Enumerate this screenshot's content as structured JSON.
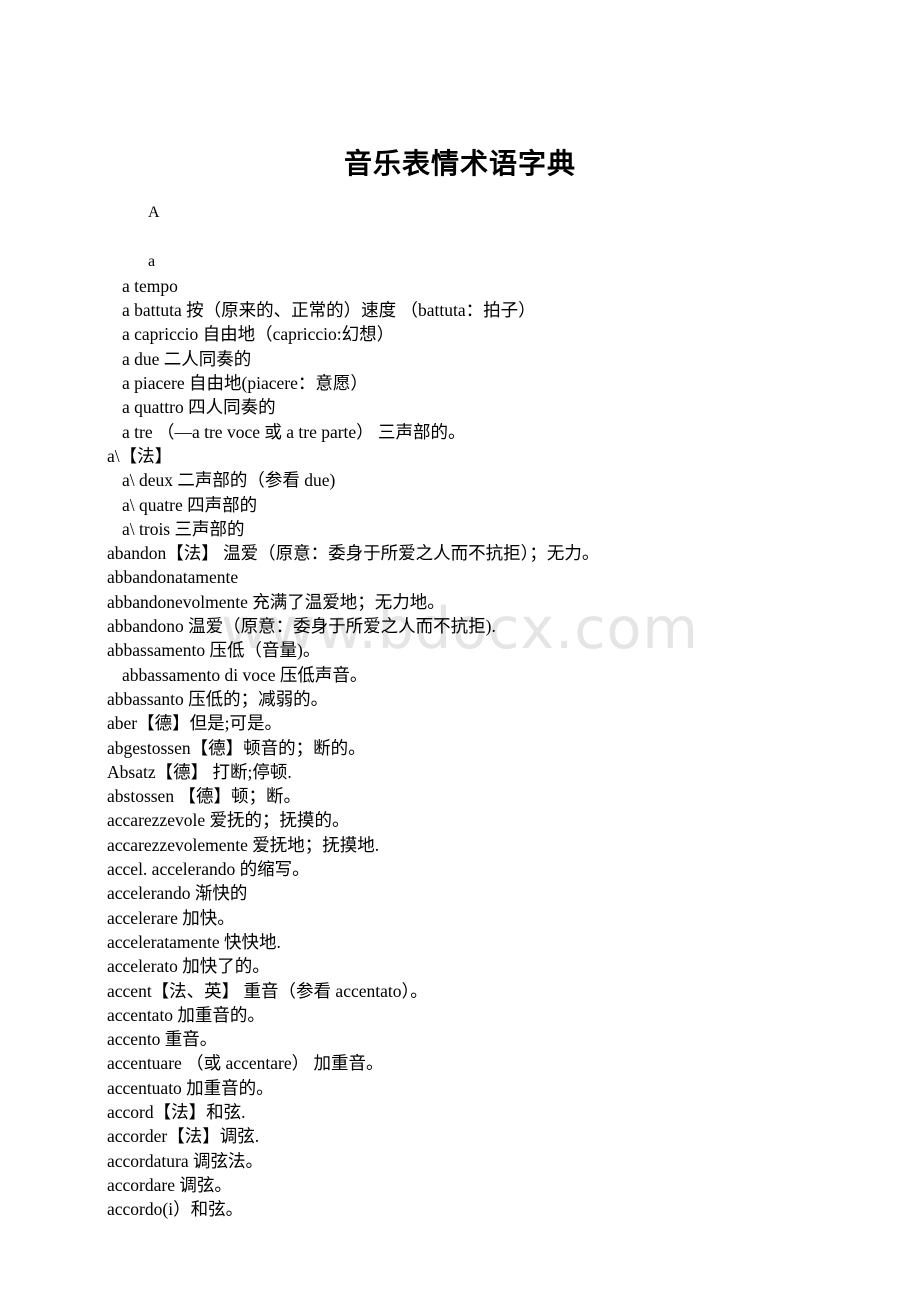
{
  "document": {
    "title": "音乐表情术语字典",
    "watermark": "www.bdocx.com"
  },
  "entries": [
    {
      "text": "A",
      "indent": 2,
      "kind": "header"
    },
    {
      "text": "",
      "indent": 0,
      "kind": "blank"
    },
    {
      "text": "a",
      "indent": 2,
      "kind": "header"
    },
    {
      "text": "a tempo",
      "indent": 1,
      "kind": "entry"
    },
    {
      "text": "a battuta  按（原来的、正常的）速度 （battuta：拍子）",
      "indent": 1,
      "kind": "entry"
    },
    {
      "text": "a capriccio 自由地（capriccio:幻想）",
      "indent": 1,
      "kind": "entry"
    },
    {
      "text": "a due  二人同奏的",
      "indent": 1,
      "kind": "entry"
    },
    {
      "text": "a piacere 自由地(piacere：意愿）",
      "indent": 1,
      "kind": "entry"
    },
    {
      "text": "a quattro 四人同奏的",
      "indent": 1,
      "kind": "entry"
    },
    {
      "text": "a tre （—a tre voce 或 a tre parte） 三声部的。",
      "indent": 1,
      "kind": "entry"
    },
    {
      "text": "a\\【法】",
      "indent": 0,
      "kind": "entry"
    },
    {
      "text": "a\\ deux 二声部的（参看 due)",
      "indent": 1,
      "kind": "entry"
    },
    {
      "text": "a\\ quatre 四声部的",
      "indent": 1,
      "kind": "entry"
    },
    {
      "text": "a\\ trois 三声部的",
      "indent": 1,
      "kind": "entry"
    },
    {
      "text": "abandon【法】 温爱（原意：委身于所爱之人而不抗拒）；无力。",
      "indent": 0,
      "kind": "entry"
    },
    {
      "text": "abbandonatamente",
      "indent": 0,
      "kind": "entry"
    },
    {
      "text": "abbandonevolmente 充满了温爱地；无力地。",
      "indent": 0,
      "kind": "entry"
    },
    {
      "text": "abbandono 温爱（原意：委身于所爱之人而不抗拒).",
      "indent": 0,
      "kind": "entry"
    },
    {
      "text": "abbassamento 压低（音量)。",
      "indent": 0,
      "kind": "entry"
    },
    {
      "text": "abbassamento di voce 压低声音。",
      "indent": 1,
      "kind": "entry"
    },
    {
      "text": "abbassanto 压低的；减弱的。",
      "indent": 0,
      "kind": "entry"
    },
    {
      "text": "aber【德】但是;可是。",
      "indent": 0,
      "kind": "entry"
    },
    {
      "text": "abgestossen【德】顿音的；断的。",
      "indent": 0,
      "kind": "entry"
    },
    {
      "text": "Absatz【德】 打断;停顿.",
      "indent": 0,
      "kind": "entry"
    },
    {
      "text": "abstossen 【德】顿；断。",
      "indent": 0,
      "kind": "entry"
    },
    {
      "text": "accarezzevole 爱抚的；抚摸的。",
      "indent": 0,
      "kind": "entry"
    },
    {
      "text": "accarezzevolemente 爱抚地；抚摸地.",
      "indent": 0,
      "kind": "entry"
    },
    {
      "text": "accel.   accelerando 的缩写。",
      "indent": 0,
      "kind": "entry"
    },
    {
      "text": "accelerando 渐快的",
      "indent": 0,
      "kind": "entry"
    },
    {
      "text": "accelerare 加快。",
      "indent": 0,
      "kind": "entry"
    },
    {
      "text": "acceleratamente 快快地.",
      "indent": 0,
      "kind": "entry"
    },
    {
      "text": "accelerato 加快了的。",
      "indent": 0,
      "kind": "entry"
    },
    {
      "text": "accent【法、英】 重音（参看 accentato）。",
      "indent": 0,
      "kind": "entry"
    },
    {
      "text": "accentato 加重音的。",
      "indent": 0,
      "kind": "entry"
    },
    {
      "text": "accento 重音。",
      "indent": 0,
      "kind": "entry"
    },
    {
      "text": "accentuare （或 accentare） 加重音。",
      "indent": 0,
      "kind": "entry"
    },
    {
      "text": "accentuato 加重音的。",
      "indent": 0,
      "kind": "entry"
    },
    {
      "text": "accord【法】和弦.",
      "indent": 0,
      "kind": "entry"
    },
    {
      "text": "accorder【法】调弦.",
      "indent": 0,
      "kind": "entry"
    },
    {
      "text": "accordatura 调弦法。",
      "indent": 0,
      "kind": "entry"
    },
    {
      "text": "accordare 调弦。",
      "indent": 0,
      "kind": "entry"
    },
    {
      "text": "accordo(i）和弦。",
      "indent": 0,
      "kind": "entry"
    }
  ]
}
